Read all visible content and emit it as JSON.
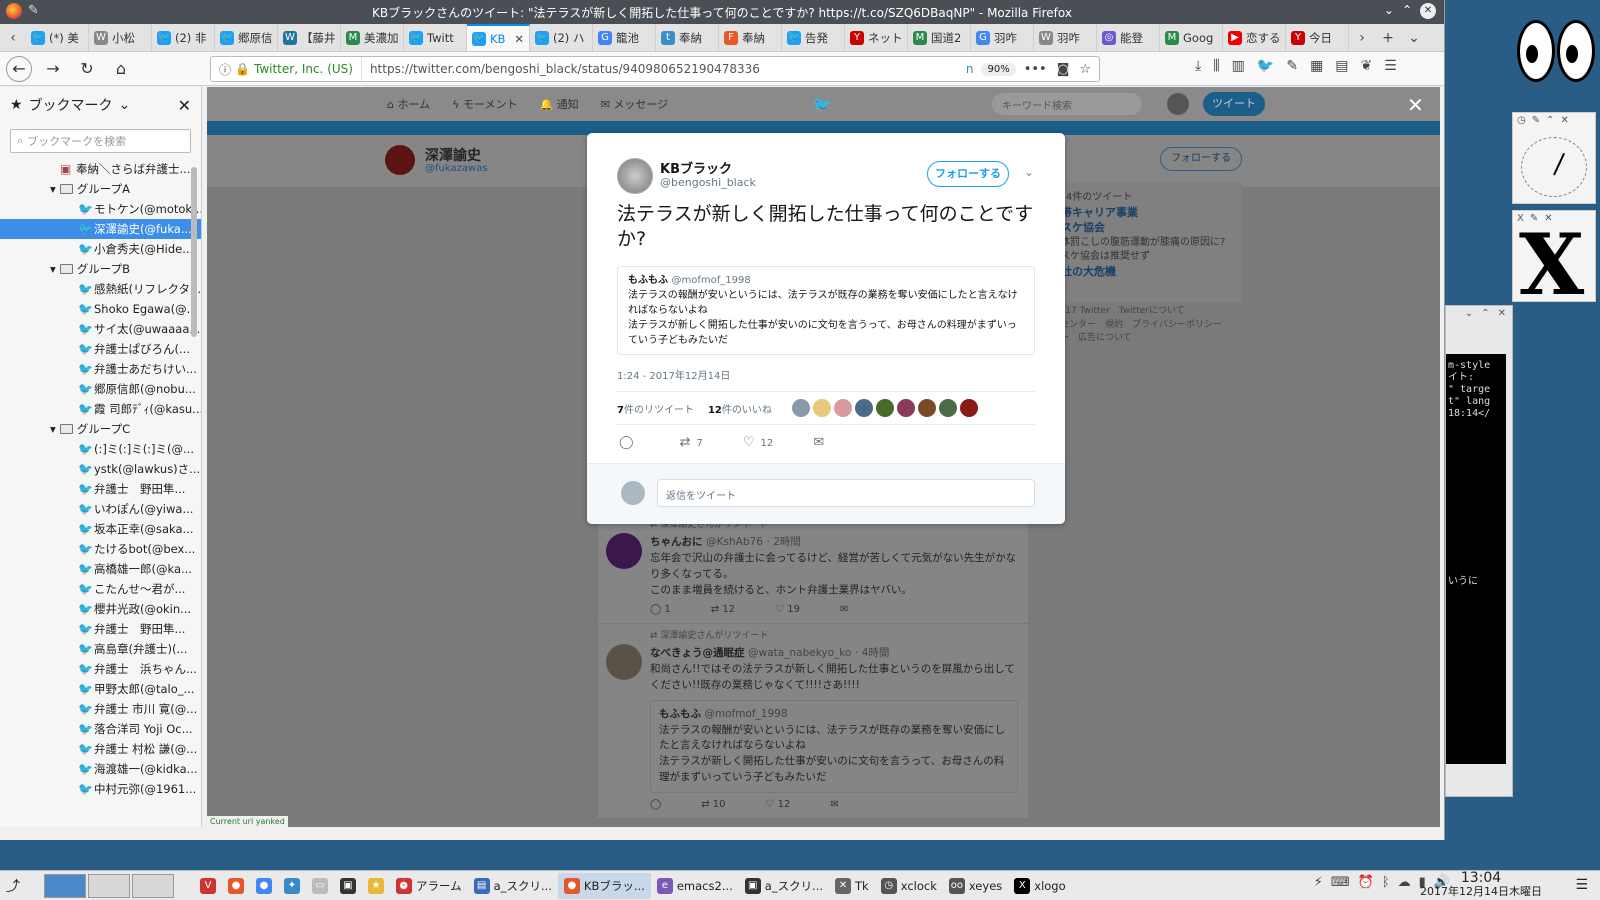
{
  "window": {
    "title": "KBブラックさんのツイート: \"法テラスが新しく開拓した仕事って何のことですか? https://t.co/SZQ6DBaqNP\" - Mozilla Firefox"
  },
  "tabs": [
    {
      "label": "(*) 美",
      "color": "#1da1f2",
      "glyph": "🐦"
    },
    {
      "label": "小松",
      "color": "#888",
      "glyph": "W"
    },
    {
      "label": "(2) 非",
      "color": "#1da1f2",
      "glyph": "🐦"
    },
    {
      "label": "郷原信",
      "color": "#1da1f2",
      "glyph": "🐦"
    },
    {
      "label": "【藤井",
      "color": "#21759b",
      "glyph": "W"
    },
    {
      "label": "美濃加",
      "color": "#2a8a4a",
      "glyph": "M"
    },
    {
      "label": "Twitt",
      "color": "#1da1f2",
      "glyph": "🐦"
    },
    {
      "label": "KB",
      "color": "#1da1f2",
      "glyph": "🐦",
      "active": true
    },
    {
      "label": "(2) ハ",
      "color": "#1da1f2",
      "glyph": "🐦"
    },
    {
      "label": "籠池",
      "color": "#4285f4",
      "glyph": "G"
    },
    {
      "label": "奉納",
      "color": "#3b8ec8",
      "glyph": "t"
    },
    {
      "label": "奉納",
      "color": "#e8572a",
      "glyph": "F"
    },
    {
      "label": "告発",
      "color": "#1da1f2",
      "glyph": "🐦"
    },
    {
      "label": "ネット",
      "color": "#c00",
      "glyph": "Y"
    },
    {
      "label": "国道2",
      "color": "#2a8a4a",
      "glyph": "M"
    },
    {
      "label": "羽咋",
      "color": "#4285f4",
      "glyph": "G"
    },
    {
      "label": "羽咋",
      "color": "#888",
      "glyph": "W"
    },
    {
      "label": "能登",
      "color": "#6a5acd",
      "glyph": "◎"
    },
    {
      "label": "Goog",
      "color": "#2a8a4a",
      "glyph": "M"
    },
    {
      "label": "恋する",
      "color": "#e00",
      "glyph": "▶"
    },
    {
      "label": "今日",
      "color": "#c00",
      "glyph": "Y"
    }
  ],
  "urlbar": {
    "identity": "Twitter, Inc. (US)",
    "url": "https://twitter.com/bengoshi_black/status/940980652190478336",
    "zoom": "90%"
  },
  "sidebar": {
    "title": "ブックマーク",
    "search_placeholder": "ブックマークを検索",
    "items": [
      {
        "label": "奉納＼さらば弁護士...",
        "indent": 60,
        "type": "page"
      },
      {
        "label": "グループA",
        "indent": 50,
        "type": "folder"
      },
      {
        "label": "モトケン(@motok...",
        "indent": 78,
        "type": "tw"
      },
      {
        "label": "深澤諭史(@fuka...",
        "indent": 78,
        "type": "tw",
        "selected": true
      },
      {
        "label": "小倉秀夫(@Hide...",
        "indent": 78,
        "type": "tw"
      },
      {
        "label": "グループB",
        "indent": 50,
        "type": "folder"
      },
      {
        "label": "感熱紙(リフレクタ...",
        "indent": 78,
        "type": "tw"
      },
      {
        "label": "Shoko Egawa(@...",
        "indent": 78,
        "type": "tw"
      },
      {
        "label": "サイ太(@uwaaaa...",
        "indent": 78,
        "type": "tw"
      },
      {
        "label": "弁護士ぱびろん(...",
        "indent": 78,
        "type": "tw"
      },
      {
        "label": "弁護士あだちけい...",
        "indent": 78,
        "type": "tw"
      },
      {
        "label": "郷原信郎(@nobu...",
        "indent": 78,
        "type": "tw"
      },
      {
        "label": "霞 司郎ﾃﾞｨ(@kasu...",
        "indent": 78,
        "type": "tw"
      },
      {
        "label": "グループC",
        "indent": 50,
        "type": "folder"
      },
      {
        "label": "(:]ミ(:]ミ(:]ミ(@...",
        "indent": 78,
        "type": "tw"
      },
      {
        "label": "ystk(@lawkus)さ...",
        "indent": 78,
        "type": "tw"
      },
      {
        "label": "弁護士　野田隼...",
        "indent": 78,
        "type": "tw"
      },
      {
        "label": "いわぽん(@yiwa...",
        "indent": 78,
        "type": "tw"
      },
      {
        "label": "坂本正幸(@saka...",
        "indent": 78,
        "type": "tw"
      },
      {
        "label": "たけるbot(@bex...",
        "indent": 78,
        "type": "tw"
      },
      {
        "label": "高橋雄一郎(@ka...",
        "indent": 78,
        "type": "tw"
      },
      {
        "label": "こたんせ〜君が...",
        "indent": 78,
        "type": "tw"
      },
      {
        "label": "櫻井光政(@okin...",
        "indent": 78,
        "type": "tw"
      },
      {
        "label": "弁護士　野田隼...",
        "indent": 78,
        "type": "tw"
      },
      {
        "label": "高島章(弁護士)(...",
        "indent": 78,
        "type": "tw"
      },
      {
        "label": "弁護士　浜ちゃん...",
        "indent": 78,
        "type": "tw"
      },
      {
        "label": "甲野太郎(@talo_...",
        "indent": 78,
        "type": "tw"
      },
      {
        "label": "弁護士 市川 寛(@...",
        "indent": 78,
        "type": "tw"
      },
      {
        "label": "落合洋司 Yoji Oc...",
        "indent": 78,
        "type": "tw"
      },
      {
        "label": "弁護士 村松 謙(@...",
        "indent": 78,
        "type": "tw"
      },
      {
        "label": "海渡雄一(@kidka...",
        "indent": 78,
        "type": "tw"
      },
      {
        "label": "中村元弥(@1961...",
        "indent": 78,
        "type": "tw"
      }
    ]
  },
  "twitter_nav": {
    "home": "ホーム",
    "moments": "モーメント",
    "notifications": "通知",
    "messages": "メッセージ",
    "search_placeholder": "キーワード検索",
    "tweet_button": "ツイート"
  },
  "profile": {
    "name": "深澤諭史",
    "handle": "@fukazawas",
    "follow_label": "フォローする"
  },
  "side_card": {
    "line1": ",434件のツイート",
    "link1": "携帯キャリア事業",
    "link2": "バスケ協会",
    "line2": "に体罰こしの腹筋運動が膝痛の原因に?バスケ協会は推奨せず",
    "link3": "自社の大危機"
  },
  "footer": {
    "line1": "© 2017 Twitter　Twitterについて",
    "line2": "ルプセンター　規約　プライバシーポリシー",
    "line3": "ッキー　広告について"
  },
  "modal": {
    "name": "KBブラック",
    "handle": "@bengoshi_black",
    "follow_label": "フォローする",
    "text": "法テラスが新しく開拓した仕事って何のことですか?",
    "quote": {
      "name": "もふもふ",
      "handle": "@mofmof_1998",
      "line1": "法テラスの報酬が安いというには、法テラスが既存の業務を奪い安価にしたと言えなければならないよね",
      "line2": "法テラスが新しく開拓した仕事が安いのに文句を言うって、お母さんの料理がまずいっていう子どもみたいだ"
    },
    "timestamp": "1:24 - 2017年12月14日",
    "retweets_count": "7",
    "retweets_label": "件のリツイート",
    "likes_count": "12",
    "likes_label": "件のいいね",
    "liker_colors": [
      "#8a9aa8",
      "#e8c87a",
      "#d89a9a",
      "#4a6a8a",
      "#4a6a2a",
      "#8a3a5a",
      "#7a4a2a",
      "#4a6a4a",
      "#8a1a1a"
    ],
    "action_retweet": "7",
    "action_like": "12",
    "reply_placeholder": "返信をツイート"
  },
  "timeline": [
    {
      "rt_label": "深澤諭史さんがリツイート",
      "name": "ちゃんおに",
      "handle": "@KshAb76",
      "time": "· 2時間",
      "body": "忘年会で沢山の弁護士に会ってるけど、経営が苦しくて元気がない先生がかなり多くなってる。\nこのまま増員を続けると、ホント弁護士業界はヤバい。",
      "reply": "1",
      "retweet": "12",
      "like": "19"
    },
    {
      "rt_label": "深澤諭史さんがリツイート",
      "name": "なべきょう@通眠症",
      "handle": "@wata_nabekyo_ko",
      "time": "· 4時間",
      "body": "和尚さん!!ではその法テラスが新しく開拓した仕事というのを屏風から出してください!!既存の業務じゃなくて!!!!さあ!!!!",
      "quote_name": "もふもふ",
      "quote_handle": "@mofmof_1998",
      "quote_body": "法テラスの報酬が安いというには、法テラスが既存の業務を奪い安価にしたと言えなければならないよね\n法テラスが新しく開拓した仕事が安いのに文句を言うって、お母さんの料理がまずいっていう子どもみたいだ",
      "reply": "",
      "retweet": "10",
      "like": "12"
    }
  ],
  "status_strip": "Current url yanked",
  "emacs_lines": [
    "m-style",
    "イト:",
    "\" targe",
    "t\" lang",
    "18:14</",
    "",
    "",
    "",
    "",
    "",
    "",
    "",
    "",
    "",
    "",
    "",
    "",
    "",
    "いうに"
  ],
  "taskbar": {
    "tasks": [
      {
        "label": "",
        "glyph": "V",
        "color": "#c33"
      },
      {
        "label": "",
        "glyph": "●",
        "color": "#e8572a"
      },
      {
        "label": "",
        "glyph": "●",
        "color": "#4285f4"
      },
      {
        "label": "",
        "glyph": "✦",
        "color": "#3a8ac8"
      },
      {
        "label": "",
        "glyph": "▭",
        "color": "#bbb"
      },
      {
        "label": "",
        "glyph": "▣",
        "color": "#333"
      },
      {
        "label": "",
        "glyph": "★",
        "color": "#e8b83a"
      },
      {
        "label": "アラーム",
        "glyph": "⏰",
        "color": "#c33"
      },
      {
        "label": "a_スクリ...",
        "glyph": "▤",
        "color": "#3a6ab8"
      },
      {
        "label": "KBブラッ...",
        "glyph": "●",
        "color": "#e8572a",
        "active": true
      },
      {
        "label": "emacs2...",
        "glyph": "e",
        "color": "#7a5ab8"
      },
      {
        "label": "a_スクリ...",
        "glyph": "▣",
        "color": "#333"
      },
      {
        "label": "Tk",
        "glyph": "✕",
        "color": "#666"
      },
      {
        "label": "xclock",
        "glyph": "◷",
        "color": "#555"
      },
      {
        "label": "xeyes",
        "glyph": "oo",
        "color": "#555"
      },
      {
        "label": "xlogo",
        "glyph": "X",
        "color": "#000"
      }
    ],
    "clock_time": "13:04",
    "clock_date": "2017年12月14日木曜日"
  }
}
